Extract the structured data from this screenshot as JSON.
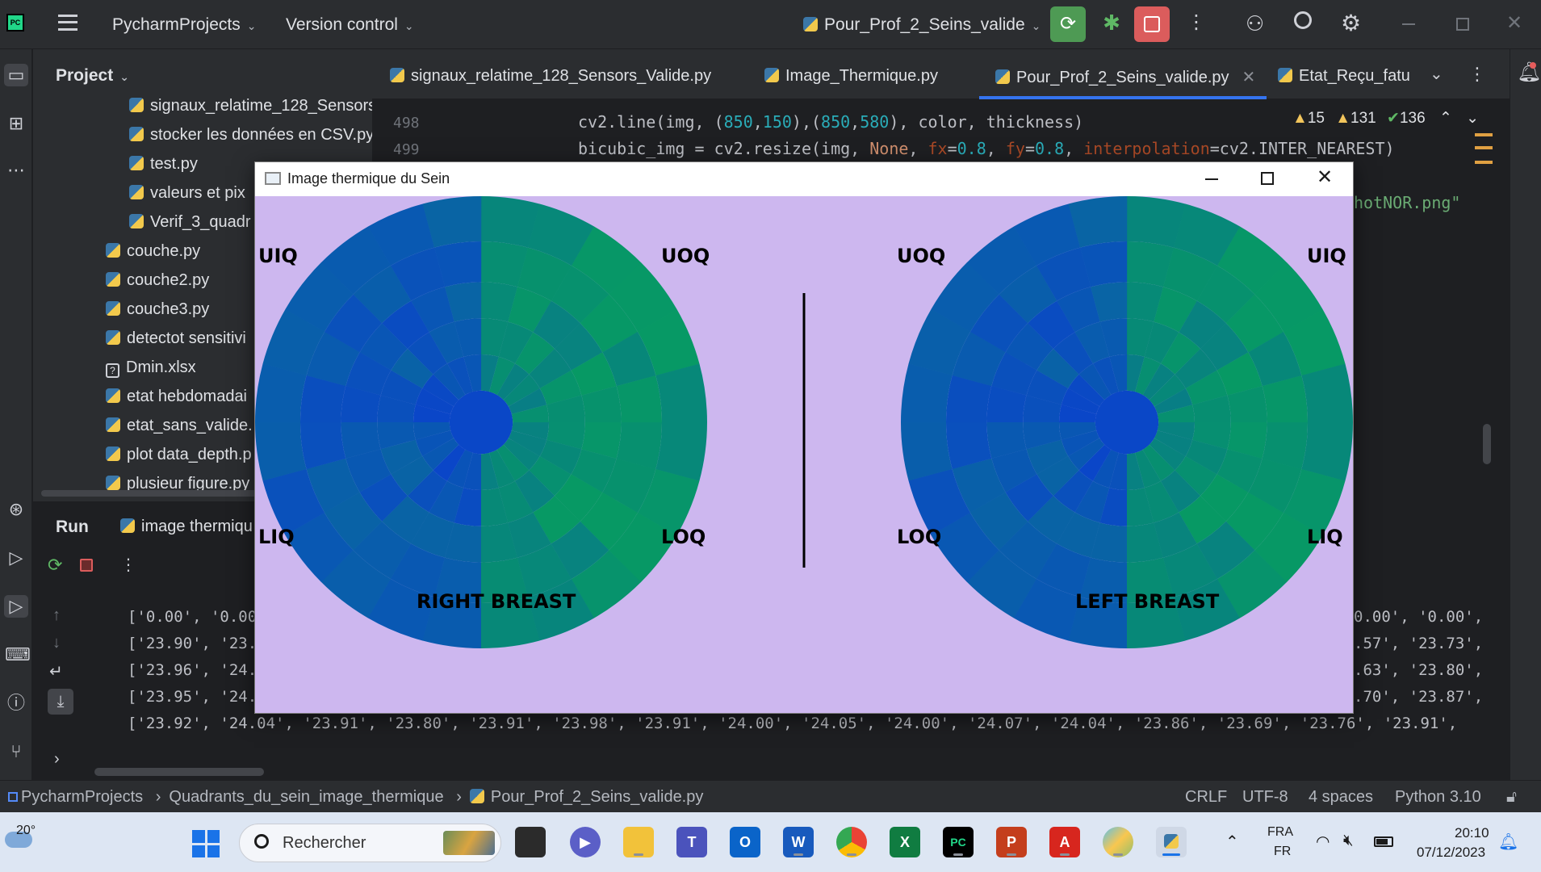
{
  "titlebar": {
    "app_icon": "PC",
    "project": "PycharmProjects",
    "vcs": "Version control",
    "run_config": "Pour_Prof_2_Seins_valide"
  },
  "project_panel": {
    "title": "Project",
    "items": [
      "signaux_relatime_128_Sensors",
      "stocker les données en CSV.py",
      "test.py",
      "valeurs et pix",
      "Verif_3_quadr",
      "couche.py",
      "couche2.py",
      "couche3.py",
      "detectot sensitivi",
      "Dmin.xlsx",
      "etat hebdomadai",
      "etat_sans_valide.",
      "plot data_depth.p",
      "plusieur figure.py"
    ]
  },
  "editor": {
    "tabs": [
      "signaux_relatime_128_Sensors_Valide.py",
      "Image_Thermique.py",
      "Pour_Prof_2_Seins_valide.py",
      "Etat_Reçu_fatu"
    ],
    "inspections": {
      "warnings": "15",
      "weak_warnings": "131",
      "ok": "136"
    },
    "lines": [
      {
        "num": "498",
        "code": "cv2.line(img, (850,150),(850,580), color, thickness)"
      },
      {
        "num": "499",
        "code": "bicubic_img = cv2.resize(img, None, fx=0.8, fy=0.8, interpolation=cv2.INTER_NEAREST)"
      }
    ],
    "partial_text": "hotNOR.png\""
  },
  "run_panel": {
    "title": "Run",
    "config_tab": "image thermiqu",
    "output_lines": [
      "['0.00', '0.00',",
      "['23.90', '23.97'",
      "['23.96', '24.02'",
      "['23.95', '24.04'",
      "['23.92', '24.04', '23.91', '23.80', '23.91', '23.98', '23.91', '24.00', '24.05', '24.00', '24.07', '24.04', '23.86', '23.69', '23.76', '23.91',"
    ],
    "right_fragments": [
      "0.00', '0.00',",
      ".57', '23.73',",
      ".63', '23.80',",
      ".70', '23.87',"
    ]
  },
  "popup": {
    "title": "Image thermique du Sein",
    "background": "#cdb7ef",
    "right_breast": {
      "label": "RIGHT BREAST",
      "q_tl": "UIQ",
      "q_tr": "UOQ",
      "q_bl": "LIQ",
      "q_br": "LOQ"
    },
    "left_breast": {
      "label": "LEFT BREAST",
      "q_tl": "UOQ",
      "q_tr": "UIQ",
      "q_bl": "LOQ",
      "q_br": "LIQ"
    }
  },
  "statusbar": {
    "breadcrumb": [
      "PycharmProjects",
      "Quadrants_du_sein_image_thermique",
      "Pour_Prof_2_Seins_valide.py"
    ],
    "line_sep": "CRLF",
    "encoding": "UTF-8",
    "indent": "4 spaces",
    "interpreter": "Python 3.10"
  },
  "taskbar": {
    "weather": "20°",
    "search_placeholder": "Rechercher",
    "lang_top": "FRA",
    "lang_bottom": "FR",
    "time": "20:10",
    "date": "07/12/2023"
  }
}
